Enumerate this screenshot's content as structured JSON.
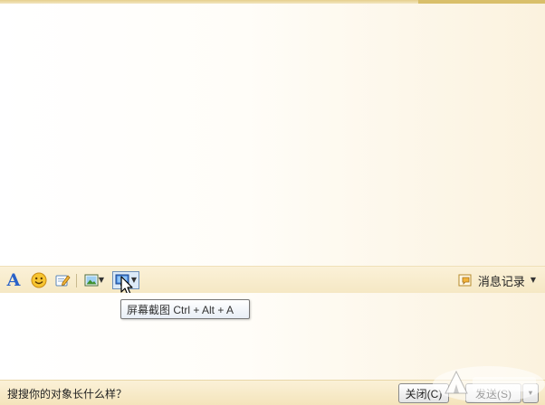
{
  "toolbar": {
    "font_glyph": "A",
    "tooltip": "屏幕截图 Ctrl + Alt + A",
    "history_label": "消息记录"
  },
  "bottom": {
    "ad_text": "搜搜你的对象长什么样？",
    "close_label": "关闭(C)",
    "send_label": "发送(S)"
  },
  "colors": {
    "accent_blue": "#2a62c8",
    "background": "#fbf5e6",
    "toolbar_top": "#fbf1d8"
  }
}
